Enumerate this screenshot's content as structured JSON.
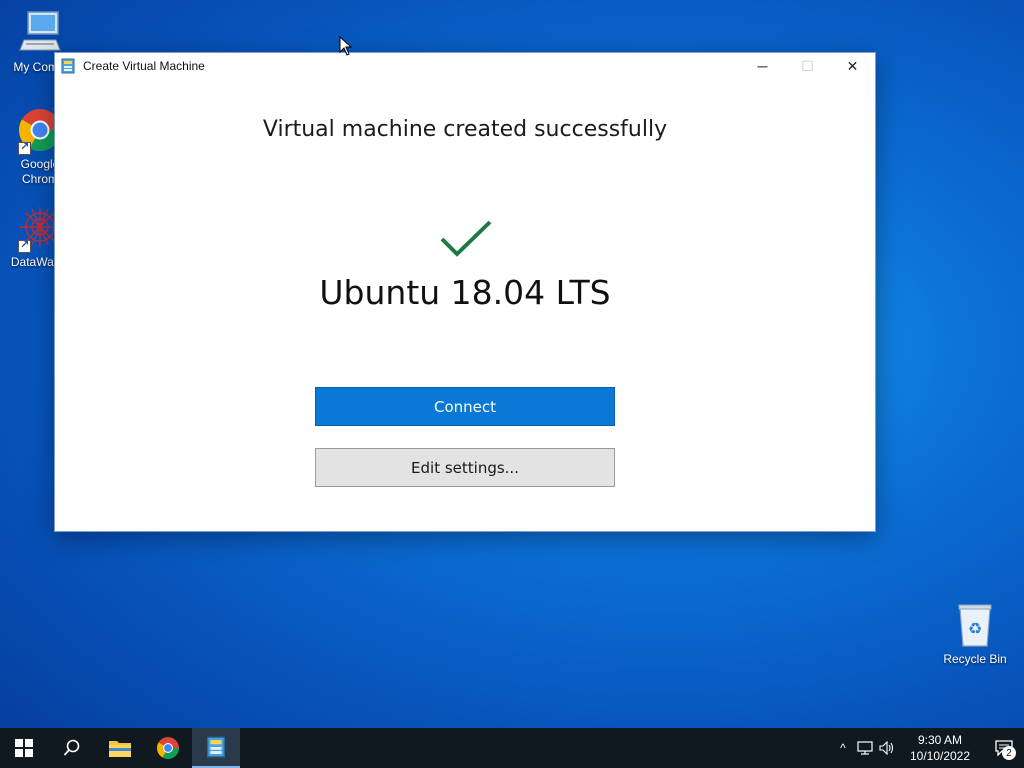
{
  "desktop": {
    "icons": [
      {
        "label": "My Comp",
        "icon": "computer-icon"
      },
      {
        "label": "Google Chrom",
        "icon": "chrome-icon"
      },
      {
        "label": "DataWago",
        "icon": "datawagon-icon"
      },
      {
        "label": "Recycle Bin",
        "icon": "recycle-bin-icon"
      }
    ]
  },
  "window": {
    "title": "Create Virtual Machine",
    "controls": {
      "minimize": "─",
      "maximize": "☐",
      "close": "✕"
    },
    "heading": "Virtual machine created successfully",
    "vm_name": "Ubuntu 18.04 LTS",
    "connect_label": "Connect",
    "edit_label": "Edit settings...",
    "success_color": "#1e7a45",
    "accent_color": "#0a78d7"
  },
  "taskbar": {
    "time": "9:30 AM",
    "date": "10/10/2022",
    "notification_count": "2",
    "tray": {
      "chevron": "^",
      "network": "network-icon",
      "volume": "volume-icon"
    }
  }
}
